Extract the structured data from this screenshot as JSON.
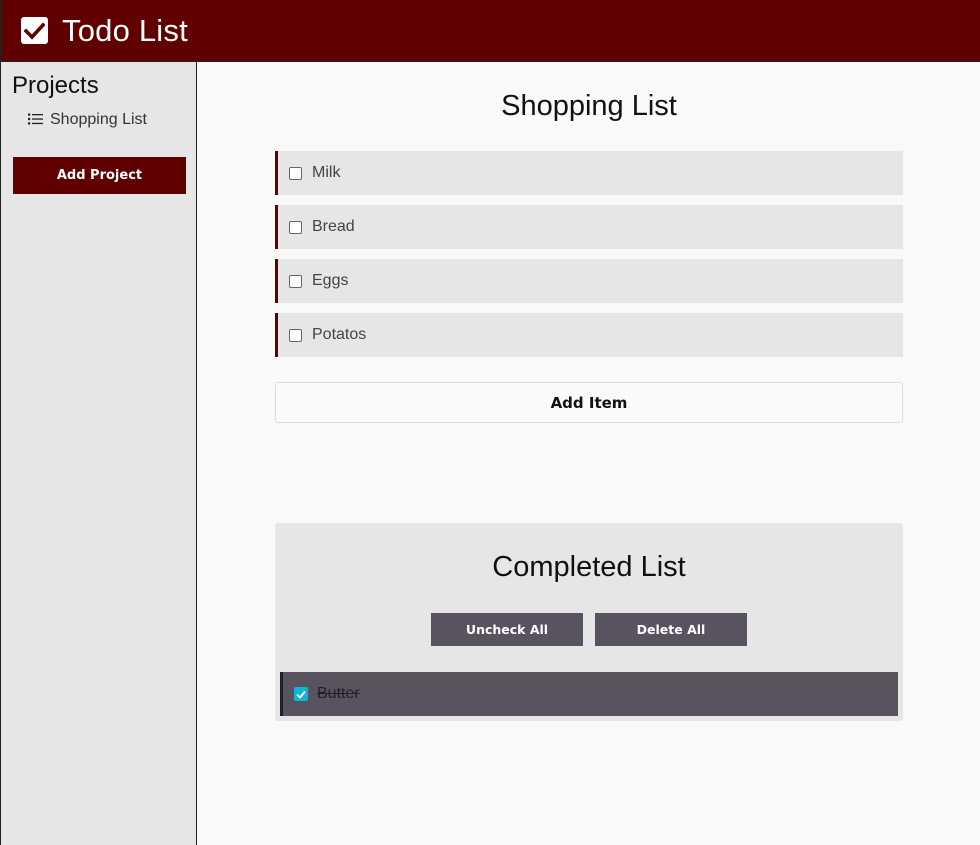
{
  "header": {
    "title": "Todo List",
    "logo_icon": "check-square-icon",
    "color": "#600000"
  },
  "sidebar": {
    "heading": "Projects",
    "projects": [
      {
        "label": "Shopping List",
        "icon": "list-icon"
      }
    ],
    "add_project_label": "Add Project"
  },
  "main": {
    "list_title": "Shopping List",
    "items": [
      {
        "label": "Milk",
        "checked": false
      },
      {
        "label": "Bread",
        "checked": false
      },
      {
        "label": "Eggs",
        "checked": false
      },
      {
        "label": "Potatos",
        "checked": false
      }
    ],
    "add_item_label": "Add Item"
  },
  "completed": {
    "title": "Completed List",
    "uncheck_all_label": "Uncheck All",
    "delete_all_label": "Delete All",
    "items": [
      {
        "label": "Butter",
        "checked": true
      }
    ],
    "check_color": "#11b5d4"
  }
}
